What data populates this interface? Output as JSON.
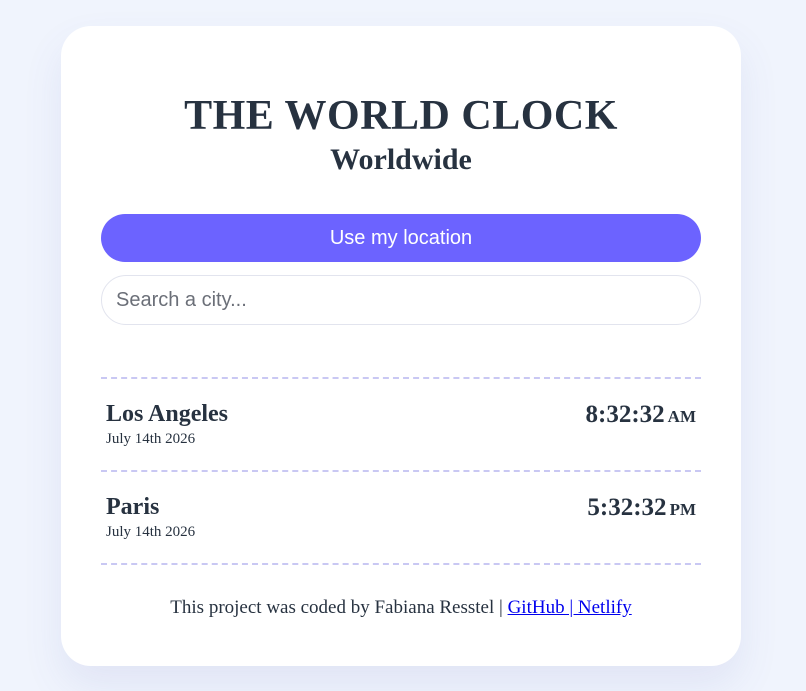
{
  "header": {
    "title": "THE WORLD CLOCK",
    "subtitle": "Worldwide"
  },
  "location_button": {
    "label": "Use my location"
  },
  "search": {
    "placeholder": "Search a city...",
    "value": ""
  },
  "cities": [
    {
      "name": "Los Angeles",
      "date": "July 14th 2026",
      "time": "8:32:32",
      "period": "AM"
    },
    {
      "name": "Paris",
      "date": "July 14th 2026",
      "time": "5:32:32",
      "period": "PM"
    }
  ],
  "footer": {
    "text": "This project was coded by Fabiana Resstel | ",
    "link_label": "GitHub | Netlify"
  },
  "colors": {
    "background": "#f0f4fd",
    "card": "#ffffff",
    "accent": "#6c63ff",
    "text": "#273240",
    "divider": "#c9c8f3",
    "link": "#0000ee"
  }
}
